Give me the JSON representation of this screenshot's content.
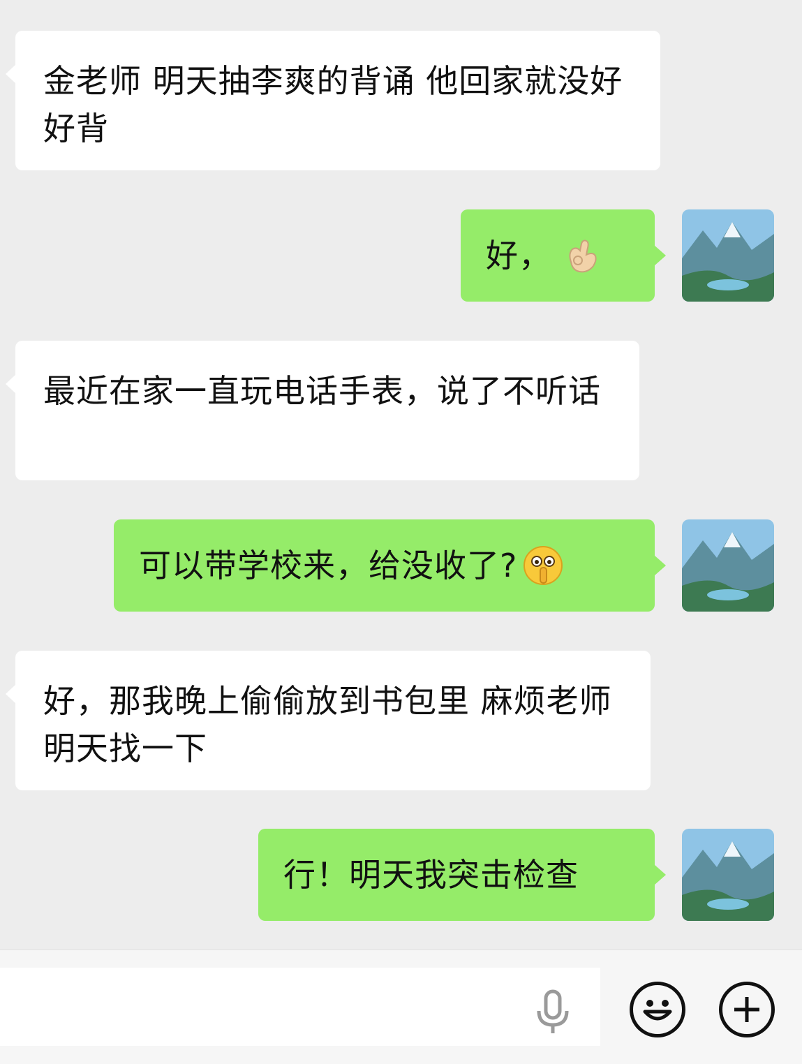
{
  "messages": [
    {
      "side": "left",
      "text": "金老师 明天抽李爽的背诵 他回家就没好好背"
    },
    {
      "side": "right",
      "text": "好，",
      "emoji": "ok-hand-emoji"
    },
    {
      "side": "left",
      "text": "最近在家一直玩电话手表，说了不听话"
    },
    {
      "side": "right",
      "text": "可以带学校来，给没收了?",
      "emoji": "shushing-face-emoji"
    },
    {
      "side": "left",
      "text": "好，那我晚上偷偷放到书包里 麻烦老师明天找一下"
    },
    {
      "side": "right",
      "text": "行！明天我突击检查"
    }
  ],
  "input": {
    "value": "",
    "placeholder": ""
  },
  "icons": {
    "voice": "microphone-icon",
    "sticker": "smiley-face-icon",
    "more": "plus-icon"
  },
  "colors": {
    "background": "#ededed",
    "incoming_bubble": "#ffffff",
    "outgoing_bubble": "#95ec69"
  }
}
